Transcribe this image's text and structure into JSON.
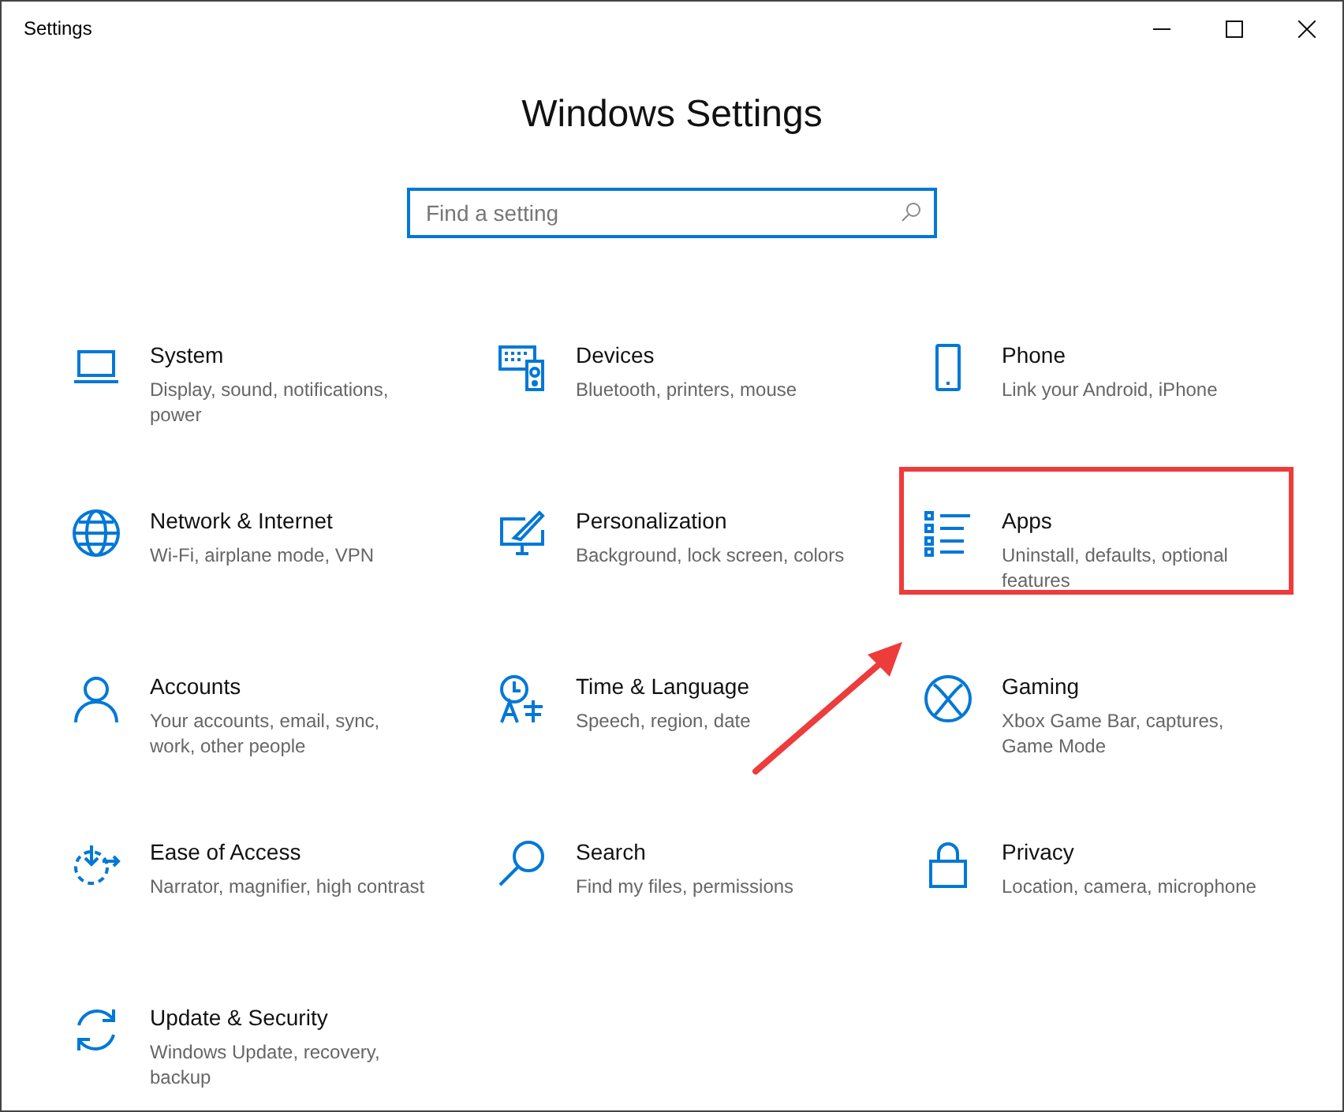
{
  "window": {
    "title": "Settings"
  },
  "heading": "Windows Settings",
  "search": {
    "placeholder": "Find a setting"
  },
  "items": [
    {
      "kind": "system",
      "label": "System",
      "description": "Display, sound, notifications, power",
      "highlighted": false
    },
    {
      "kind": "devices",
      "label": "Devices",
      "description": "Bluetooth, printers, mouse",
      "highlighted": false
    },
    {
      "kind": "phone",
      "label": "Phone",
      "description": "Link your Android, iPhone",
      "highlighted": false
    },
    {
      "kind": "network",
      "label": "Network & Internet",
      "description": "Wi-Fi, airplane mode, VPN",
      "highlighted": false
    },
    {
      "kind": "personalization",
      "label": "Personalization",
      "description": "Background, lock screen, colors",
      "highlighted": false
    },
    {
      "kind": "apps",
      "label": "Apps",
      "description": "Uninstall, defaults, optional features",
      "highlighted": true
    },
    {
      "kind": "accounts",
      "label": "Accounts",
      "description": "Your accounts, email, sync, work, other people",
      "highlighted": false
    },
    {
      "kind": "time",
      "label": "Time & Language",
      "description": "Speech, region, date",
      "highlighted": false
    },
    {
      "kind": "gaming",
      "label": "Gaming",
      "description": "Xbox Game Bar, captures, Game Mode",
      "highlighted": false
    },
    {
      "kind": "ease",
      "label": "Ease of Access",
      "description": "Narrator, magnifier, high contrast",
      "highlighted": false
    },
    {
      "kind": "search",
      "label": "Search",
      "description": "Find my files, permissions",
      "highlighted": false
    },
    {
      "kind": "privacy",
      "label": "Privacy",
      "description": "Location, camera, microphone",
      "highlighted": false
    },
    {
      "kind": "update",
      "label": "Update & Security",
      "description": "Windows Update, recovery, backup",
      "highlighted": false
    }
  ]
}
